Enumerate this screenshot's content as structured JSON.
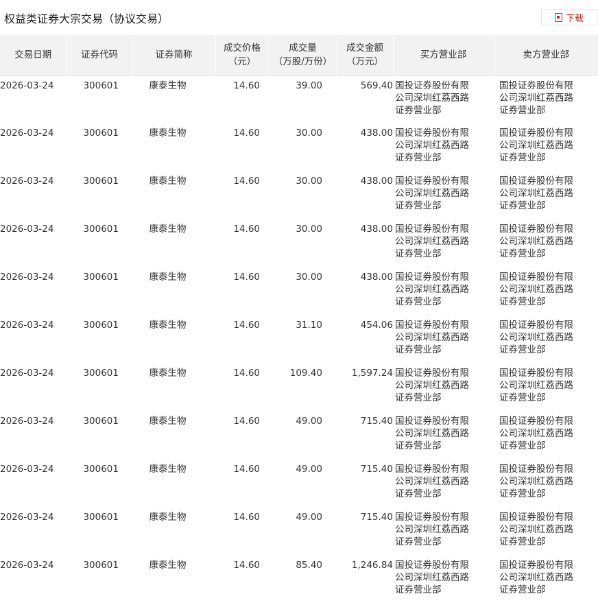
{
  "title": "权益类证券大宗交易（协议交易）",
  "download_label": "下载",
  "colors": {
    "accent": "#c0282d",
    "header_bg": "#f2f2f2"
  },
  "table": {
    "headers": [
      {
        "line1": "交易日期",
        "line2": ""
      },
      {
        "line1": "证券代码",
        "line2": ""
      },
      {
        "line1": "证券简称",
        "line2": ""
      },
      {
        "line1": "成交价格",
        "line2": "（元）"
      },
      {
        "line1": "成交量",
        "line2": "（万股/万份）"
      },
      {
        "line1": "成交金额",
        "line2": "（万元）"
      },
      {
        "line1": "买方营业部",
        "line2": ""
      },
      {
        "line1": "卖方营业部",
        "line2": ""
      }
    ],
    "rows": [
      {
        "date": "2026-03-24",
        "code": "300601",
        "name": "康泰生物",
        "price": "14.60",
        "volume": "39.00",
        "amount": "569.40",
        "buyer": "国投证券股份有限公司深圳红荔西路证券营业部",
        "seller": "国投证券股份有限公司深圳红荔西路证券营业部"
      },
      {
        "date": "2026-03-24",
        "code": "300601",
        "name": "康泰生物",
        "price": "14.60",
        "volume": "30.00",
        "amount": "438.00",
        "buyer": "国投证券股份有限公司深圳红荔西路证券营业部",
        "seller": "国投证券股份有限公司深圳红荔西路证券营业部"
      },
      {
        "date": "2026-03-24",
        "code": "300601",
        "name": "康泰生物",
        "price": "14.60",
        "volume": "30.00",
        "amount": "438.00",
        "buyer": "国投证券股份有限公司深圳红荔西路证券营业部",
        "seller": "国投证券股份有限公司深圳红荔西路证券营业部"
      },
      {
        "date": "2026-03-24",
        "code": "300601",
        "name": "康泰生物",
        "price": "14.60",
        "volume": "30.00",
        "amount": "438.00",
        "buyer": "国投证券股份有限公司深圳红荔西路证券营业部",
        "seller": "国投证券股份有限公司深圳红荔西路证券营业部"
      },
      {
        "date": "2026-03-24",
        "code": "300601",
        "name": "康泰生物",
        "price": "14.60",
        "volume": "30.00",
        "amount": "438.00",
        "buyer": "国投证券股份有限公司深圳红荔西路证券营业部",
        "seller": "国投证券股份有限公司深圳红荔西路证券营业部"
      },
      {
        "date": "2026-03-24",
        "code": "300601",
        "name": "康泰生物",
        "price": "14.60",
        "volume": "31.10",
        "amount": "454.06",
        "buyer": "国投证券股份有限公司深圳红荔西路证券营业部",
        "seller": "国投证券股份有限公司深圳红荔西路证券营业部"
      },
      {
        "date": "2026-03-24",
        "code": "300601",
        "name": "康泰生物",
        "price": "14.60",
        "volume": "109.40",
        "amount": "1,597.24",
        "buyer": "国投证券股份有限公司深圳红荔西路证券营业部",
        "seller": "国投证券股份有限公司深圳红荔西路证券营业部"
      },
      {
        "date": "2026-03-24",
        "code": "300601",
        "name": "康泰生物",
        "price": "14.60",
        "volume": "49.00",
        "amount": "715.40",
        "buyer": "国投证券股份有限公司深圳红荔西路证券营业部",
        "seller": "国投证券股份有限公司深圳红荔西路证券营业部"
      },
      {
        "date": "2026-03-24",
        "code": "300601",
        "name": "康泰生物",
        "price": "14.60",
        "volume": "49.00",
        "amount": "715.40",
        "buyer": "国投证券股份有限公司深圳红荔西路证券营业部",
        "seller": "国投证券股份有限公司深圳红荔西路证券营业部"
      },
      {
        "date": "2026-03-24",
        "code": "300601",
        "name": "康泰生物",
        "price": "14.60",
        "volume": "49.00",
        "amount": "715.40",
        "buyer": "国投证券股份有限公司深圳红荔西路证券营业部",
        "seller": "国投证券股份有限公司深圳红荔西路证券营业部"
      },
      {
        "date": "2026-03-24",
        "code": "300601",
        "name": "康泰生物",
        "price": "14.60",
        "volume": "85.40",
        "amount": "1,246.84",
        "buyer": "国投证券股份有限公司深圳红荔西路证券营业部",
        "seller": "国投证券股份有限公司深圳红荔西路证券营业部"
      }
    ]
  }
}
